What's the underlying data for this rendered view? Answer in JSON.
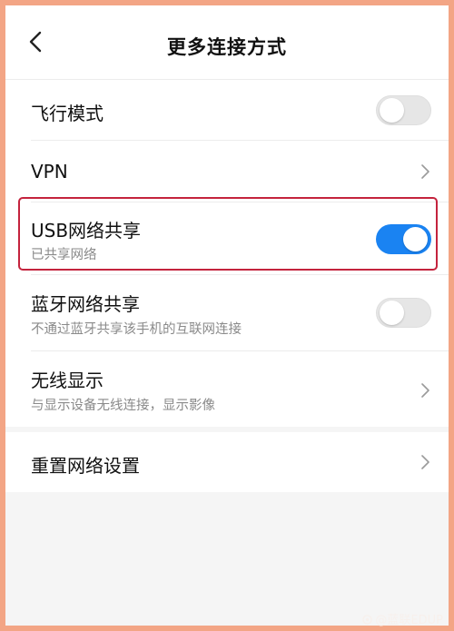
{
  "header": {
    "title": "更多连接方式"
  },
  "rows": [
    {
      "title": "飞行模式",
      "control": "toggle",
      "on": false
    },
    {
      "title": "VPN",
      "control": "chevron"
    },
    {
      "title": "USB网络共享",
      "subtitle": "已共享网络",
      "control": "toggle",
      "on": true
    },
    {
      "title": "蓝牙网络共享",
      "subtitle": "不通过蓝牙共享该手机的互联网连接",
      "control": "toggle",
      "on": false
    },
    {
      "title": "无线显示",
      "subtitle": "与显示设备无线连接，显示影像",
      "control": "chevron"
    }
  ],
  "reset": {
    "title": "重置网络设置",
    "control": "chevron"
  },
  "watermark": {
    "text": "@蓝联EDUP"
  },
  "colors": {
    "accent": "#1a83f2",
    "highlight": "#c4233d",
    "background": "#f3a585"
  },
  "icons": {
    "back": "chevron-left-icon",
    "chevron": "chevron-right-icon"
  }
}
